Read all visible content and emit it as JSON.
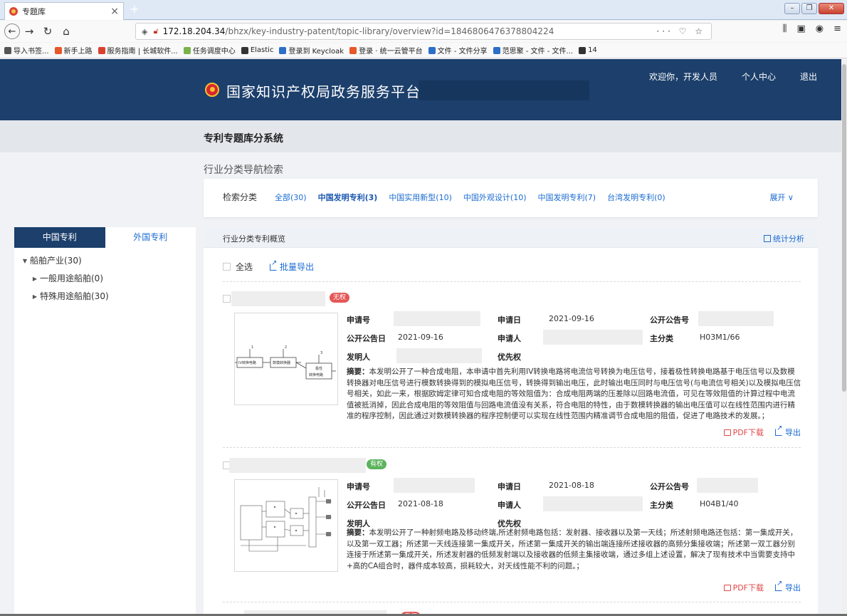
{
  "browser": {
    "tab_title": "专题库",
    "tab_close": "×",
    "new_tab": "+",
    "url_host": "172.18.204.34",
    "url_path": "/bhzx/key-industry-patent/topic-library/overview?id=1846806476378804224",
    "url_actions": "··· ♡ ☆",
    "bookmarks": [
      "导入书签...",
      "新手上路",
      "服务指南 | 长城软件...",
      "任务调度中心",
      "Elastic",
      "登录到 Keycloak",
      "登录 · 统一云管平台",
      "文件 - 文件分享",
      "范思聚 - 文件 - 文件...",
      "14"
    ],
    "bookmark_colors": [
      "#555555",
      "#e8562a",
      "#d9412e",
      "#7bb24a",
      "#333333",
      "#2c6fc8",
      "#e8562a",
      "#2c6fc8",
      "#2c6fc8",
      "#333333"
    ]
  },
  "header": {
    "site_title": "国家知识产权局政务服务平台",
    "welcome": "欢迎你，开发人员",
    "personal_center": "个人中心",
    "logout": "退出"
  },
  "subheader": {
    "title": "专利专题库分系统",
    "nav_title": "行业分类导航检索"
  },
  "filter": {
    "label": "检索分类",
    "items": [
      "全部(30)",
      "中国发明专利(3)",
      "中国实用新型(10)",
      "中国外观设计(10)",
      "中国发明专利(7)",
      "台湾发明专利(0)"
    ],
    "expand": "展开 ∨"
  },
  "left": {
    "tab_cn": "中国专利",
    "tab_foreign": "外国专利",
    "tree_root": "船舶产业(30)",
    "tree_child_1": "一般用途船舶(0)",
    "tree_child_2": "特殊用途船舶(30)"
  },
  "main": {
    "head_title": "行业分类专利概览",
    "stats": "统计分析",
    "select_all": "全选",
    "batch_export": "批量导出",
    "labels": {
      "app_no": "申请号",
      "app_date": "申请日",
      "pub_no": "公开公告号",
      "pub_date": "公开公告日",
      "applicant": "申请人",
      "main_class": "主分类",
      "inventor": "发明人",
      "priority": "优先权",
      "abstract_prefix": "摘要："
    },
    "pdf_download": "PDF下载",
    "export": "导出",
    "patents": [
      {
        "status": "无权",
        "app_date": "2021-09-16",
        "pub_date": "2021-09-16",
        "main_class": "H03M1/66",
        "abstract": "本发明公开了一种合成电阻，本申请中首先利用IV转换电路将电流信号转换为电压信号，接着极性转换电路基于电压信号以及数模转换器对电压信号进行模数转换得到的模拟电压信号，转换得到输出电压，此时输出电压同时与电压信号(与电流信号相关)以及模拟电压信号相关，如此一来，根据欧姆定律可知合成电阻的等效阻值为：合成电阻两端的压差除以回路电流值，可见在等效阻值的计算过程中电流值被抵消掉，因此合成电阻的等效阻值与回路电流值没有关系，符合电阻的特性，由于数模转换器的输出电压值可以在线性范围内进行精准的程序控制，因此通过对数模转换器的程序控制便可以实现在线性范围内精准调节合成电阻的阻值，促进了电路技术的发展。；",
        "diagram": {
          "box1": "IV转换电路",
          "box2": "数模转换器",
          "box3_line1": "极性",
          "box3_line2": "转换电路",
          "n1": "1",
          "n2": "2",
          "n3": "3"
        }
      },
      {
        "status": "有权",
        "app_date": "2021-08-18",
        "pub_date": "2021-08-18",
        "main_class": "H04B1/40",
        "abstract": "本发明公开了一种射频电路及移动终端,所述射频电路包括：发射器、接收器以及第一天线；所述射频电路还包括：第一集成开关，以及第一双工器；所述第一天线连接第一集成开关，所述第一集成开关的输出端连接所述接收器的高频分集接收端；所述第一双工器分别连接于所述第一集成开关，所述发射器的低频发射端以及接收器的低频主集接收端，通过多组上述设置，解决了现有技术中当需要支持中+高的CA组合时，器件成本较高，损耗较大，对天线性能不利的问题。；"
      },
      {
        "status": "无权"
      }
    ]
  },
  "colors": {
    "header_bg": "#1c3f6b",
    "link": "#1a6bd1",
    "badge_red": "#e45757",
    "badge_green": "#5bb35c"
  }
}
